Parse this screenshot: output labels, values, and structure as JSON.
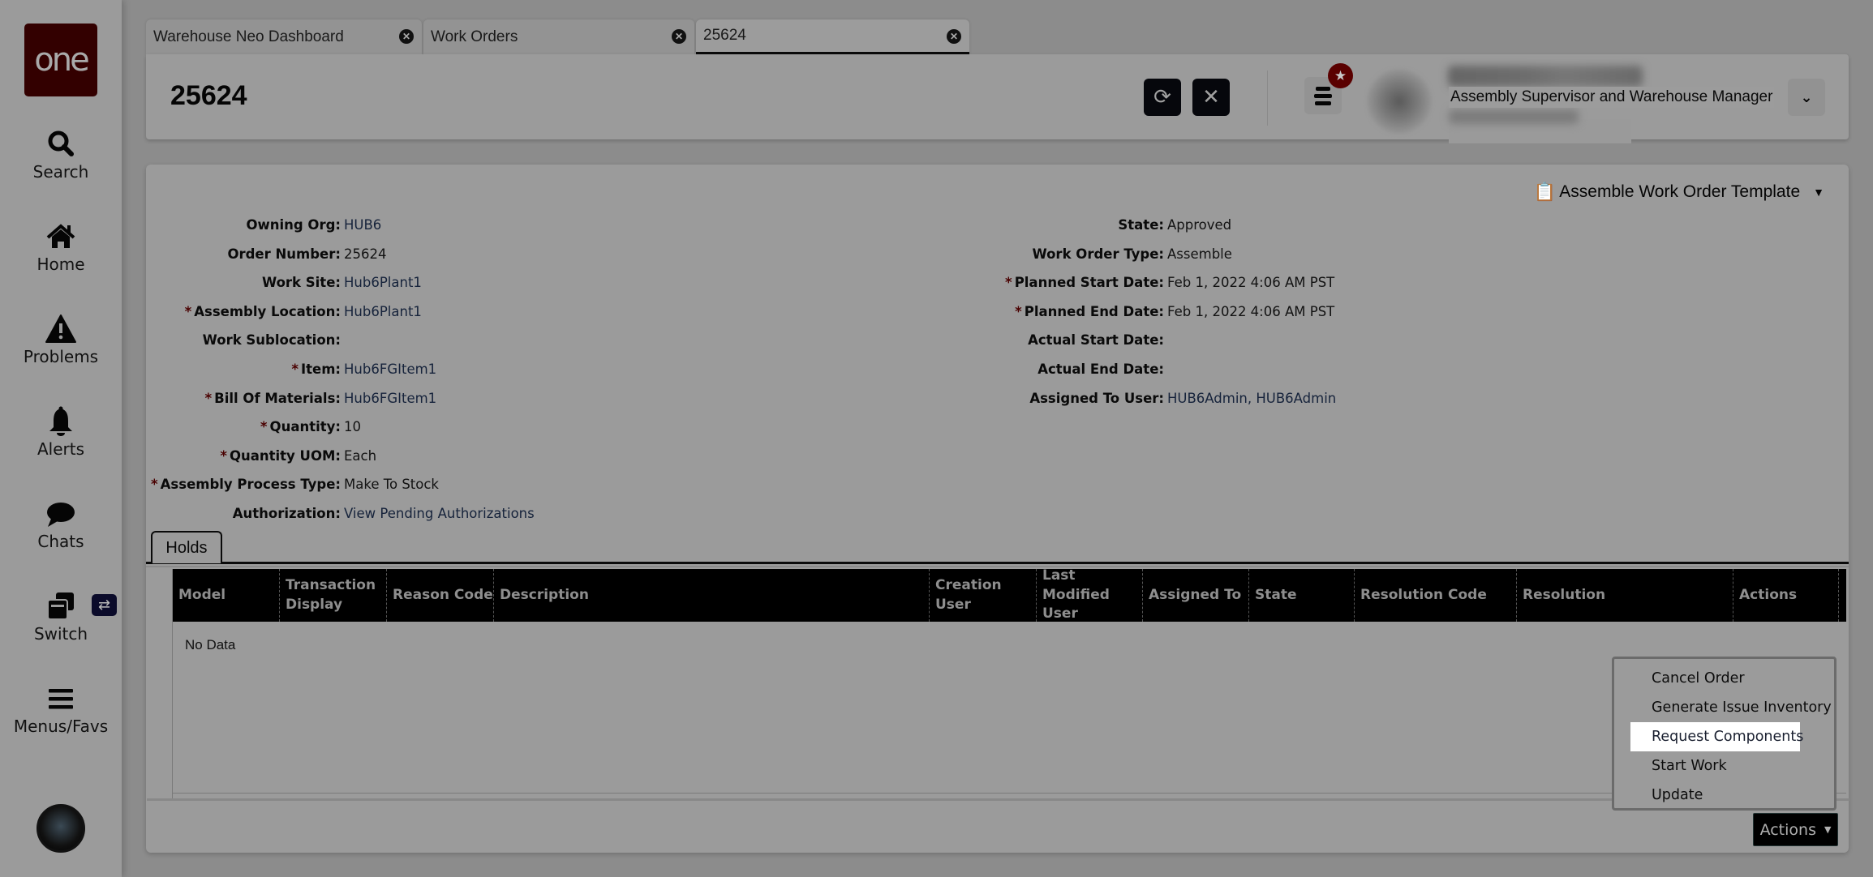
{
  "sidebar": {
    "logo_text": "one",
    "items": [
      {
        "label": "Search",
        "icon": "search-icon"
      },
      {
        "label": "Home",
        "icon": "home-icon"
      },
      {
        "label": "Problems",
        "icon": "warning-icon"
      },
      {
        "label": "Alerts",
        "icon": "bell-icon"
      },
      {
        "label": "Chats",
        "icon": "chat-icon"
      },
      {
        "label": "Switch",
        "icon": "switch-icon"
      },
      {
        "label": "Menus/Favs",
        "icon": "menu-icon"
      }
    ],
    "switch_badge": "⇄"
  },
  "tabs": [
    {
      "label": "Warehouse Neo Dashboard",
      "active": false
    },
    {
      "label": "Work Orders",
      "active": false
    },
    {
      "label": "25624",
      "active": true
    }
  ],
  "header": {
    "title": "25624",
    "refresh_icon": "⟳",
    "close_icon": "✕",
    "user_role": "Assembly Supervisor and Warehouse Manager",
    "dropdown_icon": "⌄"
  },
  "template": {
    "label": "Assemble Work Order Template"
  },
  "fields_left": [
    {
      "label": "Owning Org:",
      "value": "HUB6",
      "required": false,
      "link": true
    },
    {
      "label": "Order Number:",
      "value": "25624",
      "required": false,
      "link": false
    },
    {
      "label": "Work Site:",
      "value": "Hub6Plant1",
      "required": false,
      "link": true
    },
    {
      "label": "Assembly Location:",
      "value": "Hub6Plant1",
      "required": true,
      "link": true
    },
    {
      "label": "Work Sublocation:",
      "value": "",
      "required": false,
      "link": false
    },
    {
      "label": "Item:",
      "value": "Hub6FGItem1",
      "required": true,
      "link": true
    },
    {
      "label": "Bill Of Materials:",
      "value": "Hub6FGItem1",
      "required": true,
      "link": true
    },
    {
      "label": "Quantity:",
      "value": "10",
      "required": true,
      "link": false
    },
    {
      "label": "Quantity UOM:",
      "value": "Each",
      "required": true,
      "link": false
    },
    {
      "label": "Assembly Process Type:",
      "value": "Make To Stock",
      "required": true,
      "link": false
    },
    {
      "label": "Authorization:",
      "value": "View Pending Authorizations",
      "required": false,
      "link": true
    }
  ],
  "fields_right": [
    {
      "label": "State:",
      "value": "Approved",
      "required": false,
      "link": false
    },
    {
      "label": "Work Order Type:",
      "value": "Assemble",
      "required": false,
      "link": false
    },
    {
      "label": "Planned Start Date:",
      "value": "Feb 1, 2022 4:06 AM PST",
      "required": true,
      "link": false
    },
    {
      "label": "Planned End Date:",
      "value": "Feb 1, 2022 4:06 AM PST",
      "required": true,
      "link": false
    },
    {
      "label": "Actual Start Date:",
      "value": "",
      "required": false,
      "link": false
    },
    {
      "label": "Actual End Date:",
      "value": "",
      "required": false,
      "link": false
    },
    {
      "label": "Assigned To User:",
      "value": "HUB6Admin, HUB6Admin",
      "required": false,
      "link": true
    }
  ],
  "required_marker": "*",
  "holds": {
    "tab_label": "Holds",
    "columns": [
      "Model",
      "Transaction Display",
      "Reason Code",
      "Description",
      "Creation User",
      "Last Modified User",
      "Assigned To",
      "State",
      "Resolution Code",
      "Resolution",
      "Actions"
    ],
    "rows": [],
    "empty_text": "No Data"
  },
  "actions_menu": {
    "items": [
      "Cancel Order",
      "Generate Issue Inventory",
      "Request Components",
      "Start Work",
      "Update"
    ],
    "highlighted": "Request Components",
    "button_label": "Actions"
  },
  "colors": {
    "brand": "#330000",
    "badge": "#5a0000",
    "table_header": "#000000"
  }
}
